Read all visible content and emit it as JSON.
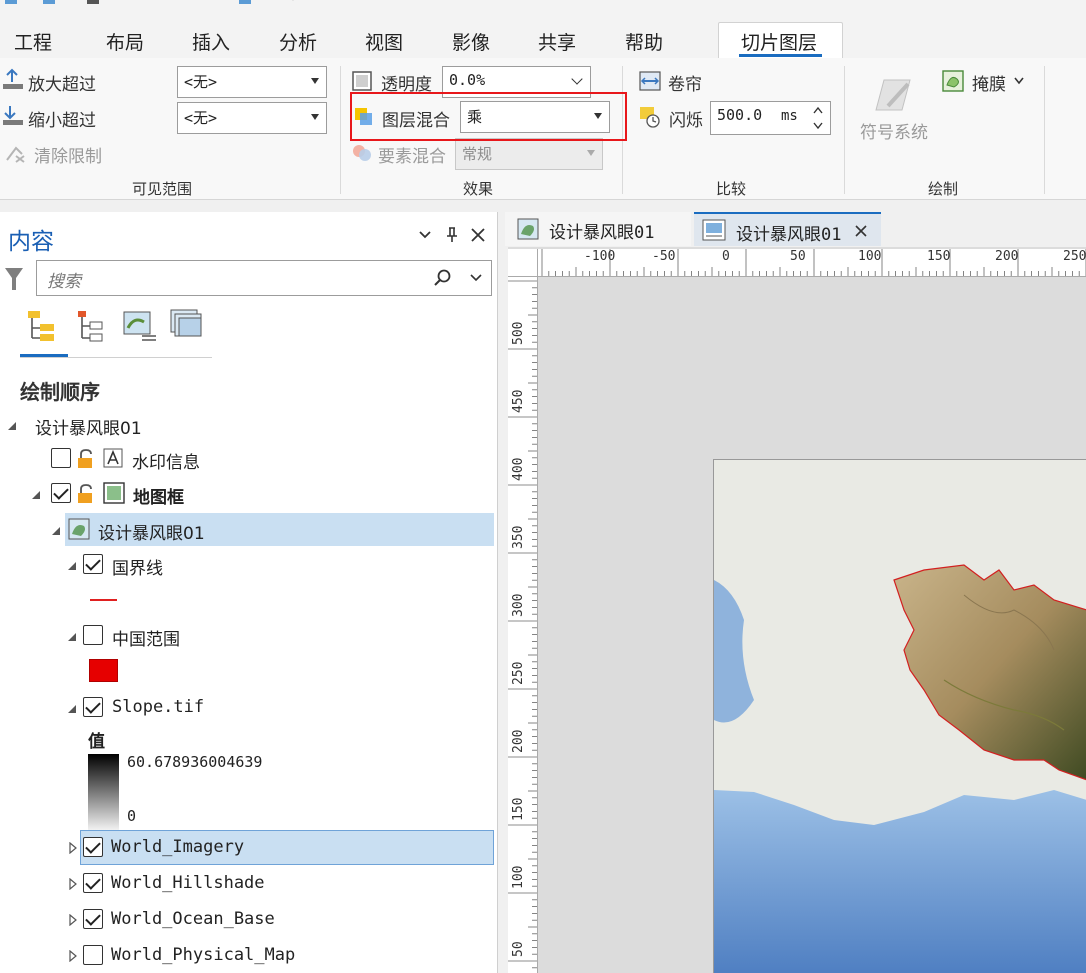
{
  "ribbon": {
    "tabs": [
      "工程",
      "布局",
      "插入",
      "分析",
      "视图",
      "影像",
      "共享",
      "帮助",
      "切片图层"
    ],
    "active_tab": "切片图层",
    "visible_range": {
      "zoom_in_beyond": "放大超过",
      "zoom_out_beyond": "缩小超过",
      "clear_limits": "清除限制",
      "zoom_in_value": "<无>",
      "zoom_out_value": "<无>",
      "group_label": "可见范围"
    },
    "effects": {
      "transparency_label": "透明度",
      "transparency_value": "0.0%",
      "layer_blend_label": "图层混合",
      "layer_blend_value": "乘",
      "feature_blend_label": "要素混合",
      "feature_blend_value": "常规",
      "group_label": "效果"
    },
    "compare": {
      "swipe_label": "卷帘",
      "flicker_label": "闪烁",
      "flicker_value": "500.0",
      "flicker_unit": "ms",
      "group_label": "比较"
    },
    "drawing": {
      "symbology_label": "符号系统",
      "mask_label": "掩膜",
      "group_label": "绘制"
    }
  },
  "contents": {
    "title": "内容",
    "search_placeholder": "搜索",
    "draw_order_title": "绘制顺序",
    "map_name": "设计暴风眼01",
    "layers": {
      "watermark": "水印信息",
      "map_frame": "地图框",
      "map": "设计暴风眼01",
      "borders": "国界线",
      "china_extent": "中国范围",
      "slope": "Slope.tif",
      "slope_value_label": "值",
      "slope_max": "60.678936004639",
      "slope_min": "0",
      "world_imagery": "World_Imagery",
      "world_hillshade": "World_Hillshade",
      "world_ocean_base": "World_Ocean_Base",
      "world_physical_map": "World_Physical_Map"
    }
  },
  "view_tabs": [
    "设计暴风眼01",
    "设计暴风眼01"
  ],
  "ruler_top": [
    "-100",
    "-50",
    "0",
    "50",
    "100",
    "150",
    "200",
    "250"
  ],
  "ruler_left": [
    "500",
    "450",
    "400",
    "350",
    "300",
    "250",
    "200",
    "150",
    "100",
    "50"
  ],
  "colors": {
    "accent": "#1a6cc0",
    "highlight_box": "#e8171b",
    "border_line": "#e02020",
    "china_fill": "#e60000",
    "selection": "#c9dff2"
  }
}
